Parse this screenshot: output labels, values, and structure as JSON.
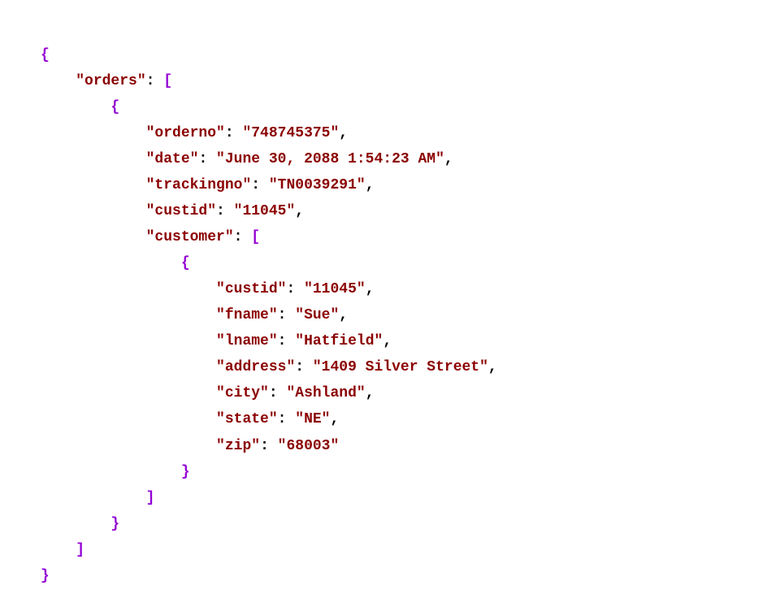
{
  "json_structure": {
    "key_orders": "\"orders\"",
    "key_orderno": "\"orderno\"",
    "val_orderno": "\"748745375\"",
    "key_date": "\"date\"",
    "val_date": "\"June 30, 2088 1:54:23 AM\"",
    "key_trackingno": "\"trackingno\"",
    "val_trackingno": "\"TN0039291\"",
    "key_custid": "\"custid\"",
    "val_custid": "\"11045\"",
    "key_customer": "\"customer\"",
    "key_custid2": "\"custid\"",
    "val_custid2": "\"11045\"",
    "key_fname": "\"fname\"",
    "val_fname": "\"Sue\"",
    "key_lname": "\"lname\"",
    "val_lname": "\"Hatfield\"",
    "key_address": "\"address\"",
    "val_address": "\"1409 Silver Street\"",
    "key_city": "\"city\"",
    "val_city": "\"Ashland\"",
    "key_state": "\"state\"",
    "val_state": "\"NE\"",
    "key_zip": "\"zip\"",
    "val_zip": "\"68003\""
  }
}
